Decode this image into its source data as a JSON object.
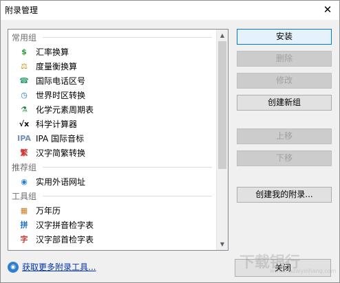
{
  "window": {
    "title": "附录管理",
    "close_glyph": "✕"
  },
  "groups": {
    "common": "常用组",
    "recommended": "推荐组",
    "tools": "工具组"
  },
  "items": [
    {
      "label": "汇率换算",
      "icon": "dollar-icon",
      "glyph": "$",
      "color": "#2a9d3a"
    },
    {
      "label": "度量衡换算",
      "icon": "scale-icon",
      "glyph": "⚖",
      "color": "#c48a00"
    },
    {
      "label": "国际电话区号",
      "icon": "phone-icon",
      "glyph": "☎",
      "color": "#2a9d6a"
    },
    {
      "label": "世界时区转换",
      "icon": "clock-icon",
      "glyph": "◷",
      "color": "#1a74c8"
    },
    {
      "label": "化学元素周期表",
      "icon": "flask-icon",
      "glyph": "⚗",
      "color": "#1e8a3c"
    },
    {
      "label": "科学计算器",
      "icon": "sqrt-icon",
      "glyph": "√x",
      "color": "#000000"
    },
    {
      "label": "IPA 国际音标",
      "icon": "ipa-icon",
      "glyph": "IPA",
      "color": "#6f8fb0"
    },
    {
      "label": "汉字简繁转换",
      "icon": "convert-icon",
      "glyph": "繁",
      "color": "#d03030"
    },
    {
      "label": "实用外语网址",
      "icon": "globe-icon",
      "glyph": "◉",
      "color": "#2a7fd0"
    },
    {
      "label": "万年历",
      "icon": "calendar-icon",
      "glyph": "▦",
      "color": "#c87a20"
    },
    {
      "label": "汉字拼音检字表",
      "icon": "pinyin-icon",
      "glyph": "拼",
      "color": "#1a6ec8"
    },
    {
      "label": "汉字部首检字表",
      "icon": "radical-icon",
      "glyph": "字",
      "color": "#d03030"
    },
    {
      "label": "",
      "icon": "partial-icon",
      "glyph": "",
      "color": "#2a9d3a"
    }
  ],
  "buttons": {
    "install": "安装",
    "delete": "删除",
    "modify": "修改",
    "create_group": "创建新组",
    "move_up": "上移",
    "move_down": "下移",
    "create_appendix": "创建我的附录...",
    "close": "关闭"
  },
  "footer": {
    "link": "获取更多附录工具..."
  },
  "watermark": {
    "main": "下载银行",
    "sub": "www.xiazaiyinhang.com"
  }
}
